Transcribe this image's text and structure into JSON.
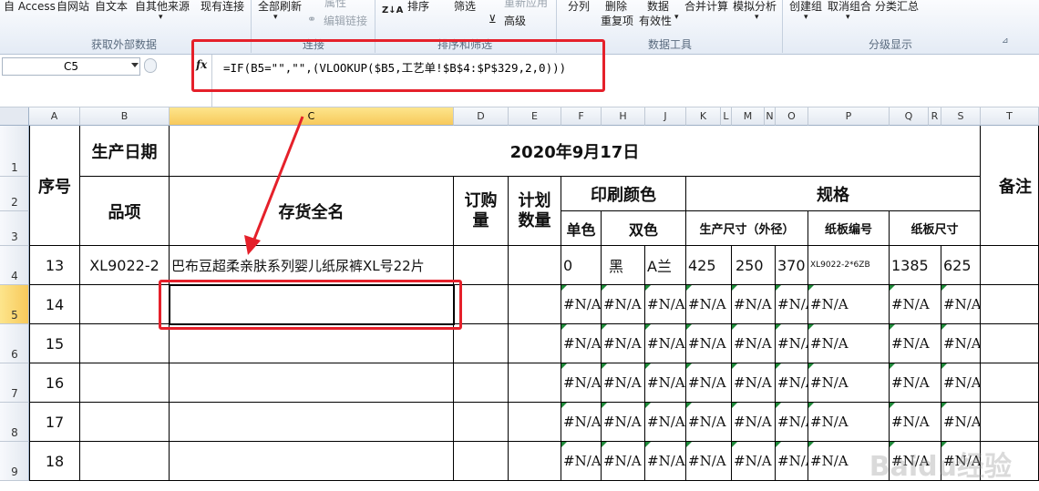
{
  "ribbon": {
    "ext_data": {
      "access": "自 Access",
      "web": "自网站",
      "text": "自文本",
      "other": "自其他来源",
      "existing": "现有连接",
      "group": "获取外部数据"
    },
    "connections": {
      "refresh": "全部刷新",
      "props": "属性",
      "edit_links": "编辑链接",
      "group": "连接"
    },
    "sort_filter": {
      "az": "Z↓A",
      "sort": "排序",
      "filter": "筛选",
      "reapply": "重新应用",
      "advanced": "高级",
      "group": "排序和筛选"
    },
    "data_tools": {
      "split": "分列",
      "remove": "删除",
      "remove2": "重复项",
      "validation": "数据",
      "validation2": "有效性",
      "consolidate": "合并计算",
      "whatif": "模拟分析",
      "group": "数据工具"
    },
    "outline": {
      "group_btn": "创建组",
      "ungroup": "取消组合",
      "subtotal": "分类汇总",
      "group": "分级显示"
    }
  },
  "formula_bar": {
    "name_box": "C5",
    "fx": "fx",
    "formula": "=IF(B5=\"\",\"\",(VLOOKUP($B5,工艺单!$B$4:$P$329,2,0)))"
  },
  "columns": [
    "A",
    "B",
    "C",
    "D",
    "E",
    "F",
    "H",
    "J",
    "K",
    "L",
    "M",
    "N",
    "O",
    "P",
    "Q",
    "R",
    "S",
    "T"
  ],
  "rows": [
    "1",
    "2",
    "3",
    "4",
    "5",
    "6",
    "7",
    "8",
    "9"
  ],
  "headers": {
    "seq": "序号",
    "prod_date": "生产日期",
    "date": "2020年9月17日",
    "item": "品项",
    "full_name": "存货全名",
    "order_qty": "订购量",
    "plan_qty": "计划数量",
    "print_color": "印刷颜色",
    "spec": "规格",
    "note": "备注",
    "single": "单色",
    "double": "双色",
    "prod_size": "生产尺寸（外径）",
    "board_no": "纸板编号",
    "board_size": "纸板尺寸"
  },
  "row4": {
    "seq": "13",
    "item": "XL9022-2",
    "name": "巴布豆超柔亲肤系列婴儿纸尿裤XL号22片",
    "f": "0",
    "h": "黑",
    "j": "A兰",
    "k": "425",
    "m": "250",
    "o": "370",
    "p": "XL9022-2*6ZB",
    "q": "1385",
    "s": "625"
  },
  "data_rows": [
    "14",
    "15",
    "16",
    "17",
    "18"
  ],
  "na": "#N/A",
  "watermark": "Baidu经验"
}
